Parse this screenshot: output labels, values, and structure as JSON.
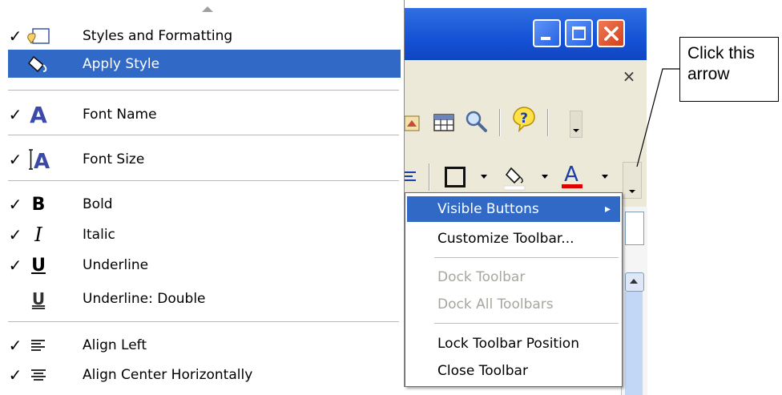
{
  "left_menu": {
    "items": [
      {
        "label": "Styles and Formatting",
        "checked": true,
        "icon": "styles-formatting-icon"
      },
      {
        "label": "Apply Style",
        "checked": false,
        "icon": "apply-style-icon",
        "highlighted": true
      },
      {
        "label": "Font Name",
        "checked": true,
        "icon": "font-name-icon",
        "glyph": "A"
      },
      {
        "label": "Font Size",
        "checked": true,
        "icon": "font-size-icon"
      },
      {
        "label": "Bold",
        "checked": true,
        "icon": "bold-icon",
        "glyph": "B"
      },
      {
        "label": "Italic",
        "checked": true,
        "icon": "italic-icon",
        "glyph": "I"
      },
      {
        "label": "Underline",
        "checked": true,
        "icon": "underline-icon",
        "glyph": "U"
      },
      {
        "label": "Underline: Double",
        "checked": false,
        "icon": "underline-double-icon",
        "glyph": "U"
      },
      {
        "label": "Align Left",
        "checked": true,
        "icon": "align-left-icon"
      },
      {
        "label": "Align Center Horizontally",
        "checked": true,
        "icon": "align-center-icon"
      }
    ],
    "check_glyph": "✓",
    "highlight_color": "#3169c6"
  },
  "context_menu": {
    "items": [
      {
        "label": "Visible Buttons",
        "highlighted": true,
        "submenu_arrow": "▸"
      },
      {
        "label": "Customize Toolbar...",
        "disabled": false
      },
      {
        "label": "Dock Toolbar",
        "disabled": true
      },
      {
        "label": "Dock All Toolbars",
        "disabled": true
      },
      {
        "label": "Lock Toolbar Position",
        "disabled": false
      },
      {
        "label": "Close Toolbar",
        "disabled": false
      }
    ]
  },
  "window": {
    "title_buttons": [
      "minimize-icon",
      "maximize-icon",
      "close-icon"
    ],
    "pane_close_glyph": "×",
    "titlebar_color": "#1552d6"
  },
  "callout": {
    "line1": "Click this",
    "line2": "arrow"
  }
}
